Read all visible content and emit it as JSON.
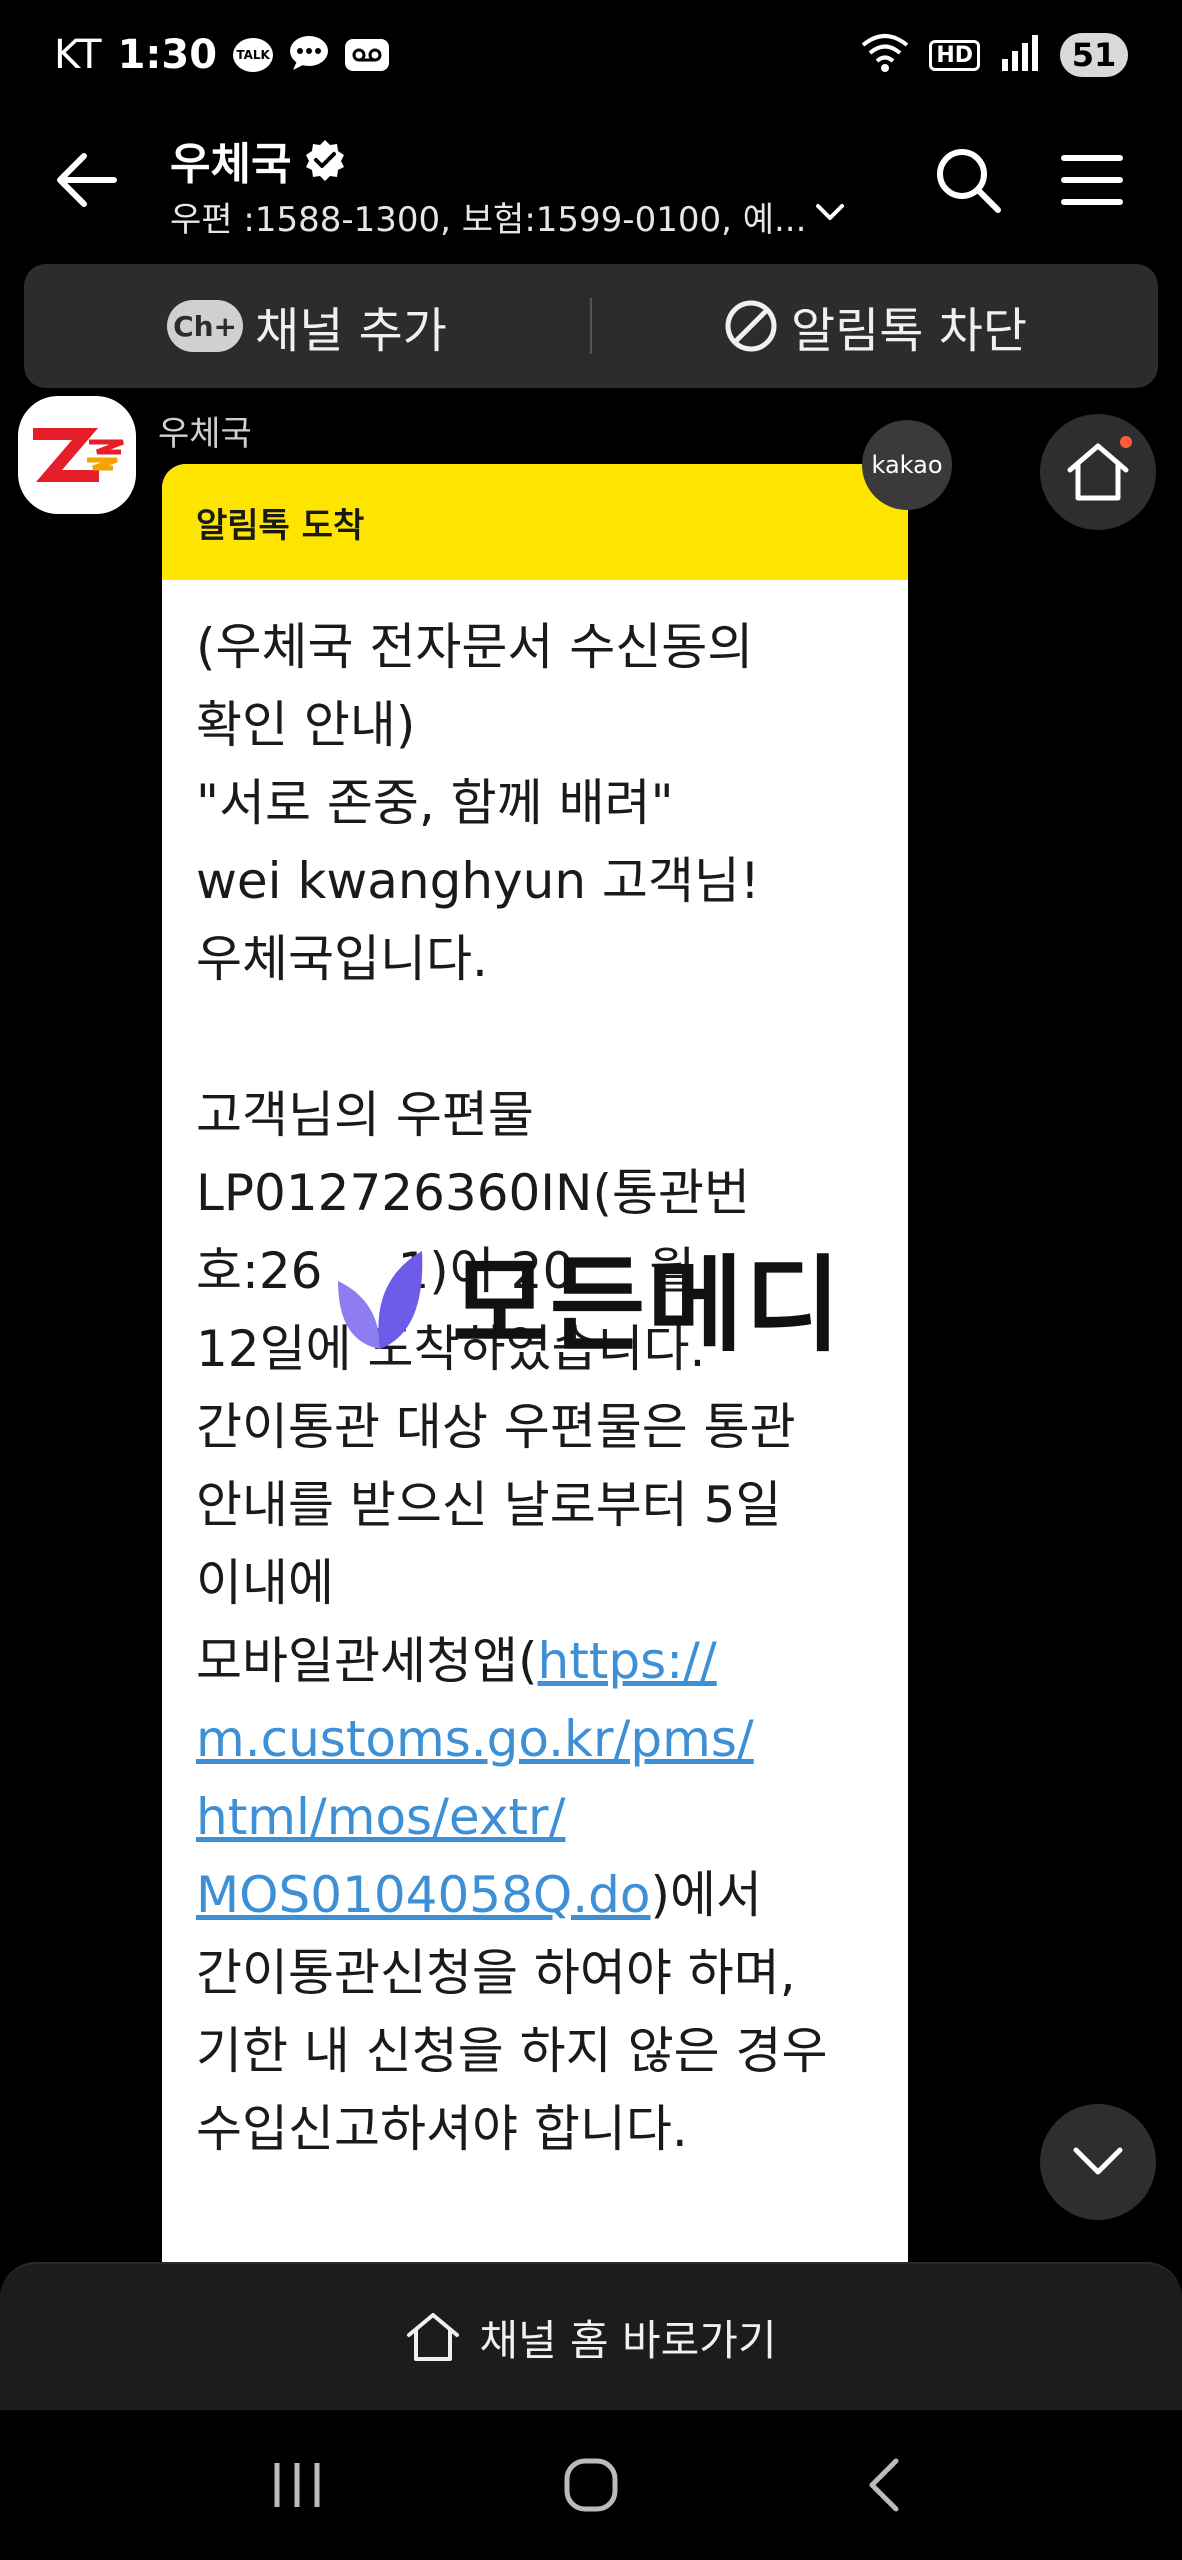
{
  "status_bar": {
    "carrier": "KT",
    "time": "1:30",
    "talk_label": "TALK",
    "hd_label": "HD",
    "battery": "51"
  },
  "header": {
    "channel_name": "우체국",
    "description": "우편 :1588-1300, 보험:1599-0100, 예..."
  },
  "actions": {
    "add_channel_icon": "Ch+",
    "add_channel": "채널 추가",
    "block_alimtalk": "알림톡 차단"
  },
  "chat": {
    "sender": "우체국",
    "kakao_badge": "kakao",
    "card_header": "알림톡 도착",
    "lines": {
      "l1": "(우체국 전자문서 수신동의",
      "l2": "확인 안내)",
      "l3": "\"서로 존중, 함께 배려\"",
      "l4": "wei kwanghyun 고객님!",
      "l5": "우체국입니다.",
      "l6": "고객님의 우편물",
      "l7": "LP012726360IN(통관번",
      "l8": "호:26   1)이 20   월",
      "l9": "12일에 도착하였습니다.",
      "l10": "간이통관 대상 우편물은 통관",
      "l11": "안내를 받으신 날로부터 5일",
      "l12": "이내에",
      "l13_pre": "모바일관세청앱(",
      "l13_link": "https://",
      "l14_link": "m.customs.go.kr/pms/",
      "l15_link": "html/mos/extr/",
      "l16_link": "MOS0104058Q.do",
      "l16_post": ")에서",
      "l17": "간이통관신청을 하여야 하며,",
      "l18": "기한 내 신청을 하지 않은 경우",
      "l19": "수입신고하셔야 합니다."
    },
    "watermark": "모든메디"
  },
  "bottom": {
    "channel_home": "채널 홈 바로가기"
  },
  "colors": {
    "card_header": "#fee500",
    "link": "#3d8fd6",
    "background": "#000000"
  }
}
